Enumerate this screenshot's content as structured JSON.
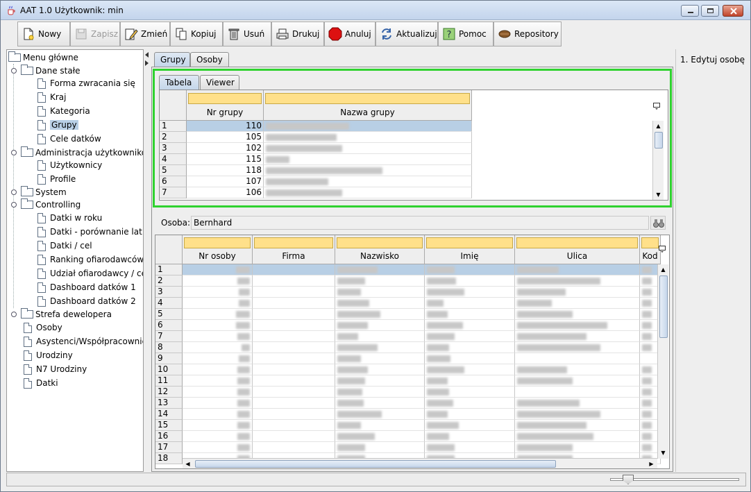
{
  "window": {
    "title": "AAT 1.0  Użytkownik: min"
  },
  "toolbar": {
    "buttons": [
      {
        "label": "Nowy",
        "icon": "new-document-icon",
        "enabled": true
      },
      {
        "label": "Zapisz",
        "icon": "save-disk-icon",
        "enabled": false
      },
      {
        "label": "Zmień",
        "icon": "edit-pencil-icon",
        "enabled": true
      },
      {
        "label": "Kopiuj",
        "icon": "copy-icon",
        "enabled": true
      },
      {
        "label": "Usuń",
        "icon": "trash-icon",
        "enabled": true
      },
      {
        "label": "Drukuj",
        "icon": "printer-icon",
        "enabled": true
      },
      {
        "label": "Anuluj",
        "icon": "stop-icon",
        "enabled": true
      },
      {
        "label": "Aktualizuj",
        "icon": "refresh-icon",
        "enabled": true
      },
      {
        "label": "Pomoc",
        "icon": "help-icon",
        "enabled": true
      },
      {
        "label": "Repository",
        "icon": "repository-icon",
        "enabled": true
      }
    ]
  },
  "tree": {
    "root": "Menu główne",
    "nodes": [
      {
        "label": "Dane stałe",
        "type": "folder",
        "level": 1
      },
      {
        "label": "Forma zwracania się",
        "type": "page",
        "level": 2
      },
      {
        "label": "Kraj",
        "type": "page",
        "level": 2
      },
      {
        "label": "Kategoria",
        "type": "page",
        "level": 2
      },
      {
        "label": "Grupy",
        "type": "page",
        "level": 2,
        "selected": true
      },
      {
        "label": "Cele datków",
        "type": "page",
        "level": 2
      },
      {
        "label": "Administracja użytkowników",
        "type": "folder",
        "level": 1
      },
      {
        "label": "Użytkownicy",
        "type": "page",
        "level": 2
      },
      {
        "label": "Profile",
        "type": "page",
        "level": 2
      },
      {
        "label": "System",
        "type": "folder",
        "level": 1
      },
      {
        "label": "Controlling",
        "type": "folder",
        "level": 1
      },
      {
        "label": "Datki w roku",
        "type": "page",
        "level": 2
      },
      {
        "label": "Datki - porównanie lat",
        "type": "page",
        "level": 2
      },
      {
        "label": "Datki / cel",
        "type": "page",
        "level": 2
      },
      {
        "label": "Ranking ofiarodawców",
        "type": "page",
        "level": 2
      },
      {
        "label": "Udział ofiarodawcy / cel",
        "type": "page",
        "level": 2
      },
      {
        "label": "Dashboard datków 1",
        "type": "page",
        "level": 2
      },
      {
        "label": "Dashboard datków 2",
        "type": "page",
        "level": 2
      },
      {
        "label": "Strefa dewelopera",
        "type": "folder",
        "level": 1
      },
      {
        "label": "Osoby",
        "type": "page",
        "level": 1
      },
      {
        "label": "Asystenci/Współpracownicy",
        "type": "page",
        "level": 1
      },
      {
        "label": "Urodziny",
        "type": "page",
        "level": 1
      },
      {
        "label": "N7 Urodziny",
        "type": "page",
        "level": 1
      },
      {
        "label": "Datki",
        "type": "page",
        "level": 1
      }
    ]
  },
  "main_tabs": [
    {
      "label": "Grupy",
      "active": true
    },
    {
      "label": "Osoby",
      "active": false
    }
  ],
  "sub_tabs": [
    {
      "label": "Tabela",
      "active": true
    },
    {
      "label": "Viewer",
      "active": false
    }
  ],
  "groups_table": {
    "columns": [
      "Nr grupy",
      "Nazwa grupy"
    ],
    "rows": [
      {
        "n": "1",
        "nr": "110"
      },
      {
        "n": "2",
        "nr": "105"
      },
      {
        "n": "3",
        "nr": "102"
      },
      {
        "n": "4",
        "nr": "115"
      },
      {
        "n": "5",
        "nr": "118"
      },
      {
        "n": "6",
        "nr": "107"
      },
      {
        "n": "7",
        "nr": "106"
      }
    ]
  },
  "osoba": {
    "label": "Osoba:",
    "value": "Bernhard"
  },
  "persons_table": {
    "columns": [
      "Nr osoby",
      "Firma",
      "Nazwisko",
      "Imię",
      "Ulica",
      "Kod"
    ],
    "row_numbers": [
      "1",
      "2",
      "3",
      "4",
      "5",
      "6",
      "7",
      "8",
      "9",
      "10",
      "11",
      "12",
      "13",
      "14",
      "15",
      "16",
      "17",
      "18"
    ]
  },
  "right_panel": {
    "text": "1. Edytuj osobę"
  },
  "colors": {
    "highlight": "#2fd22f",
    "filter": "#ffe08a",
    "selection": "#b8cfe5"
  }
}
